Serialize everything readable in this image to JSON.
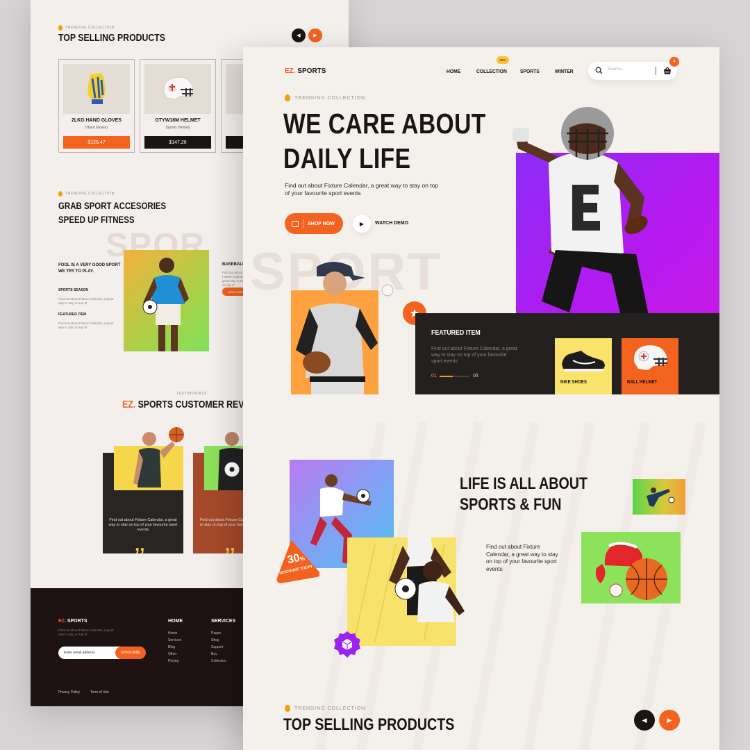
{
  "back": {
    "top_selling": {
      "eyebrow": "TRENDING COLLECTION",
      "title": "TOP SELLING PRODUCTS",
      "products": [
        {
          "name": "2LKG HAND GLOVES",
          "sub": "(Hand Gloves)",
          "price": "$126.47"
        },
        {
          "name": "GTYW18M HELMET",
          "sub": "(Sports Helmet)",
          "price": "$147.26"
        }
      ]
    },
    "accessories": {
      "eyebrow": "TRENDING COLLECTION",
      "title_line1": "GRAB SPORT ACCESORIES",
      "title_line2": "SPEED UP FITNESS",
      "bg_word": "SPOR",
      "left_heading_1": "FOOL IS A VERY GOOD SPORT",
      "left_heading_2": "WE TRY TO PLAY.",
      "item1_title": "SPORTS SEASON",
      "item1_text": "Find out about Fixture Calendar, a great way to stay on top of",
      "item2_title": "FEATURED ITEM",
      "item2_text": "Find out about Fixture Calendar, a great way to stay on top of",
      "right_heading": "BASEBALL",
      "right_button": "SHOP NOW"
    },
    "reviews": {
      "eyebrow": "TESTIMONIALS",
      "brand": "EZ.",
      "title": "SPORTS CUSTOMER REVIEWS",
      "text1": "Find out about Fixture Calendar, a great way to stay on top of your favourite sport events",
      "text2": "Find out about Fixture Calendar, a great way to stay on top of your favourite sport events"
    },
    "footer": {
      "logo_prefix": "EZ.",
      "logo_text": "SPORTS",
      "blurb": "Find out about Fixture Calendar, a great way to stay on top of",
      "email_placeholder": "Enter email address",
      "subscribe": "SUBSCRIBE",
      "col1_title": "HOME",
      "col1_items": [
        "Home",
        "Services",
        "Blog",
        "Other",
        "Pricing"
      ],
      "col2_title": "SERVICES",
      "col2_items": [
        "Pages",
        "Shop",
        "Support",
        "Buy",
        "Collection"
      ],
      "privacy": "Privacy Policy",
      "terms": "Term of Use"
    }
  },
  "front": {
    "logo_prefix": "EZ.",
    "logo_text": "SPORTS",
    "nav": [
      "HOME",
      "COLLECTION",
      "SPORTS",
      "WINTER"
    ],
    "new_badge": "New",
    "search_placeholder": "Search...",
    "cart_count": "4",
    "hero": {
      "eyebrow": "TRENDING COLLECTION",
      "title_line1": "WE CARE ABOUT",
      "title_line2": "DAILY LIFE",
      "subtitle": "Find out about Fixture Calendar, a great way to stay on top of your favourite sport events",
      "shop_button": "SHOP NOW",
      "watch_button": "WATCH  DEMO",
      "bg_word": "SPORT"
    },
    "featured": {
      "title": "FEATURED ITEM",
      "text": "Find out about Fixture Calendar, a great way to stay on top of your favourite sport events",
      "slide_current": "01",
      "slide_total": "06",
      "slide_progress": 0.45,
      "cards": [
        {
          "label": "NIKE SHOES",
          "color": "#f9e36b"
        },
        {
          "label": "BALL HELMET",
          "color": "#f4621f"
        }
      ]
    },
    "life": {
      "title_line1": "LIFE IS ALL ABOUT",
      "title_line2": "SPORTS & FUN",
      "text": "Find out about Fixture Calendar, a great way to stay on top of your favourite sport events",
      "discount_value": "30",
      "discount_unit": "%",
      "discount_label": "DISCOUNT TODAY"
    },
    "bottom": {
      "eyebrow": "TRENDING COLLECTION",
      "title": "TOP SELLING PRODUCTS"
    }
  },
  "colors": {
    "accent": "#f4621f",
    "dark": "#1a1414",
    "purple": "#9b22f2",
    "yellow": "#f9e36b",
    "green": "#8ce35b"
  }
}
